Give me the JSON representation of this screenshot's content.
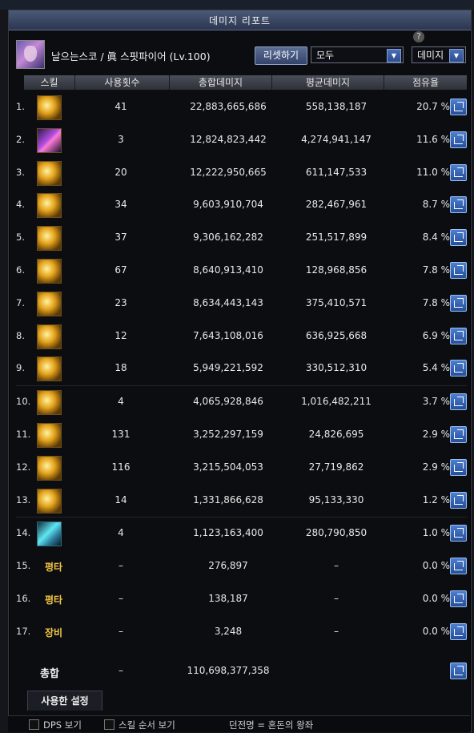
{
  "window": {
    "title": "데미지 리포트"
  },
  "header": {
    "character_name": "날으는스코 / 眞 스핏파이어 (Lv.100)",
    "reset_label": "리셋하기",
    "filter_value": "모두",
    "metric_value": "데미지"
  },
  "columns": [
    "스킬",
    "사용횟수",
    "총합데미지",
    "평균데미지",
    "점유율"
  ],
  "rows": [
    {
      "rank": "1.",
      "icon": "skill-icon-gold",
      "count": "41",
      "total": "22,883,665,686",
      "avg": "558,138,187",
      "share": "20.7 %"
    },
    {
      "rank": "2.",
      "icon": "skill-icon-purple",
      "count": "3",
      "total": "12,824,823,442",
      "avg": "4,274,941,147",
      "share": "11.6 %"
    },
    {
      "rank": "3.",
      "icon": "skill-icon-gold",
      "count": "20",
      "total": "12,222,950,665",
      "avg": "611,147,533",
      "share": "11.0 %"
    },
    {
      "rank": "4.",
      "icon": "skill-icon-gold",
      "count": "34",
      "total": "9,603,910,704",
      "avg": "282,467,961",
      "share": "8.7 %"
    },
    {
      "rank": "5.",
      "icon": "skill-icon-gold",
      "count": "37",
      "total": "9,306,162,282",
      "avg": "251,517,899",
      "share": "8.4 %"
    },
    {
      "rank": "6.",
      "icon": "skill-icon-gold",
      "count": "67",
      "total": "8,640,913,410",
      "avg": "128,968,856",
      "share": "7.8 %"
    },
    {
      "rank": "7.",
      "icon": "skill-icon-gold",
      "count": "23",
      "total": "8,634,443,143",
      "avg": "375,410,571",
      "share": "7.8 %"
    },
    {
      "rank": "8.",
      "icon": "skill-icon-gold",
      "count": "12",
      "total": "7,643,108,016",
      "avg": "636,925,668",
      "share": "6.9 %"
    },
    {
      "rank": "9.",
      "icon": "skill-icon-gold",
      "count": "18",
      "total": "5,949,221,592",
      "avg": "330,512,310",
      "share": "5.4 %"
    },
    {
      "rank": "10.",
      "icon": "skill-icon-gold",
      "count": "4",
      "total": "4,065,928,846",
      "avg": "1,016,482,211",
      "share": "3.7 %"
    },
    {
      "rank": "11.",
      "icon": "skill-icon-gold",
      "count": "131",
      "total": "3,252,297,159",
      "avg": "24,826,695",
      "share": "2.9 %"
    },
    {
      "rank": "12.",
      "icon": "skill-icon-gold",
      "count": "116",
      "total": "3,215,504,053",
      "avg": "27,719,862",
      "share": "2.9 %"
    },
    {
      "rank": "13.",
      "icon": "skill-icon-gold",
      "count": "14",
      "total": "1,331,866,628",
      "avg": "95,133,330",
      "share": "1.2 %"
    },
    {
      "rank": "14.",
      "icon": "skill-icon-cyan",
      "count": "4",
      "total": "1,123,163,400",
      "avg": "280,790,850",
      "share": "1.0 %"
    },
    {
      "rank": "15.",
      "label": "평타",
      "count": "–",
      "total": "276,897",
      "avg": "–",
      "share": "0.0 %"
    },
    {
      "rank": "16.",
      "label": "평타",
      "count": "–",
      "total": "138,187",
      "avg": "–",
      "share": "0.0 %"
    },
    {
      "rank": "17.",
      "label": "장비",
      "count": "–",
      "total": "3,248",
      "avg": "–",
      "share": "0.0 %"
    }
  ],
  "total": {
    "label": "총합",
    "count": "–",
    "total": "110,698,377,358"
  },
  "tabs": {
    "used_settings": "사용한 설정"
  },
  "footer": {
    "dps_label": "DPS 보기",
    "skill_order_label": "스킬 순서 보기",
    "dungeon_label": "던전명 = 혼돈의 왕좌"
  }
}
